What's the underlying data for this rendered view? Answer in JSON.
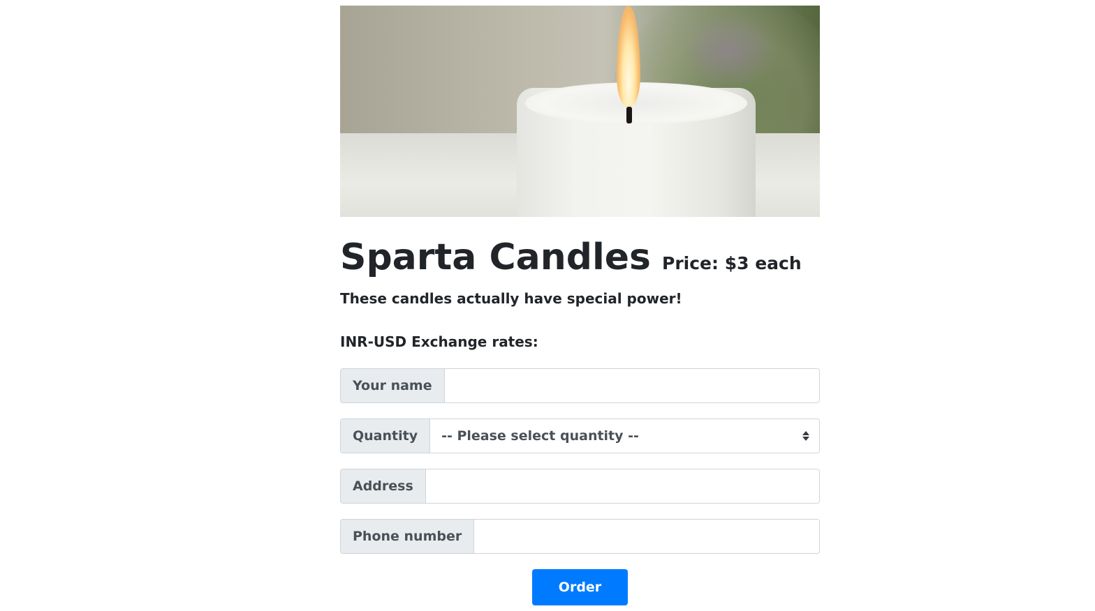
{
  "hero": {
    "image_alt": "white candle with lit flame"
  },
  "product": {
    "title": "Sparta Candles",
    "price": "Price: $3 each",
    "description": "These candles actually have special power!",
    "rates_label": "INR-USD Exchange rates:"
  },
  "form": {
    "name_label": "Your name",
    "name_value": "",
    "quantity_label": "Quantity",
    "quantity_selected": "-- Please select quantity --",
    "address_label": "Address",
    "address_value": "",
    "phone_label": "Phone number",
    "phone_value": "",
    "order_label": "Order"
  },
  "colors": {
    "accent": "#007bff",
    "addon_bg": "#e9ecef",
    "border": "#ced4da",
    "text": "#212529"
  }
}
